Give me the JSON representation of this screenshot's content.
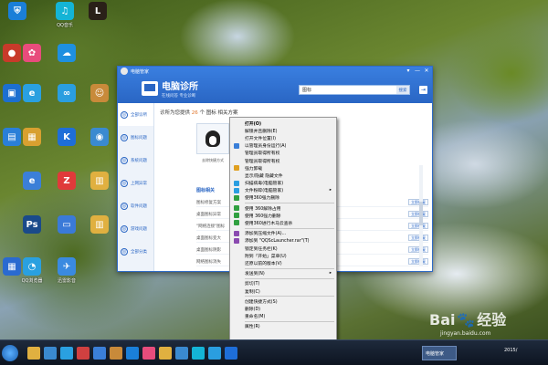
{
  "desktop": {
    "icons": [
      {
        "label": "",
        "color": "#1a7fd8",
        "glyph": "⛨"
      },
      {
        "label": "QQ音乐",
        "color": "#14b4d6",
        "glyph": "♫"
      },
      {
        "label": "",
        "color": "#2a2018",
        "glyph": "L"
      },
      {
        "label": "",
        "color": "#c83a2a",
        "glyph": "●"
      },
      {
        "label": "",
        "color": "#e84c7c",
        "glyph": "✿"
      },
      {
        "label": "",
        "color": "#1e90e0",
        "glyph": "☁"
      },
      {
        "label": "",
        "color": "#1c6fd0",
        "glyph": "▣"
      },
      {
        "label": "",
        "color": "#2aa0e0",
        "glyph": "e"
      },
      {
        "label": "",
        "color": "#2a9ee0",
        "glyph": "∞"
      },
      {
        "label": "",
        "color": "#c88a3a",
        "glyph": "☺"
      },
      {
        "label": "",
        "color": "#2a7fd8",
        "glyph": "▤"
      },
      {
        "label": "",
        "color": "#d8a030",
        "glyph": "▦"
      },
      {
        "label": "",
        "color": "#1e6ed8",
        "glyph": "K"
      },
      {
        "label": "",
        "color": "#3a8ad0",
        "glyph": "◉"
      },
      {
        "label": "",
        "color": "#3b7fd8",
        "glyph": "e"
      },
      {
        "label": "",
        "color": "#e03a3a",
        "glyph": "Z"
      },
      {
        "label": "",
        "color": "#e0b040",
        "glyph": "▥"
      },
      {
        "label": "",
        "color": "#1a4a8a",
        "glyph": "Ps"
      },
      {
        "label": "",
        "color": "#3a7ad8",
        "glyph": "▭"
      },
      {
        "label": "",
        "color": "#e0b040",
        "glyph": "▥"
      },
      {
        "label": "",
        "color": "#2a6ad0",
        "glyph": "▦"
      },
      {
        "label": "QQ浏览器",
        "color": "#2aa0e0",
        "glyph": "◔"
      },
      {
        "label": "迅雷影音",
        "color": "#3a8ae0",
        "glyph": "✈"
      }
    ]
  },
  "window": {
    "title": "电脑管家",
    "brand_title": "电脑诊所",
    "brand_subtitle": "在线问答 专业诊断",
    "search_value": "图标",
    "search_button": "搜索",
    "controls": {
      "skin": "▾",
      "minimize": "—",
      "close": "✕"
    },
    "sidebar": [
      {
        "label": "全部诊所",
        "icon": "◎"
      },
      {
        "label": "图标问题",
        "icon": "◎"
      },
      {
        "label": "系统问题",
        "icon": "◎"
      },
      {
        "label": "上网异常",
        "icon": "◎"
      },
      {
        "label": "软件问题",
        "icon": "◎"
      },
      {
        "label": "游戏问题",
        "icon": "◎"
      },
      {
        "label": "全部分类",
        "icon": "◎"
      }
    ],
    "heading_prefix": "诊所为您提供",
    "heading_count": "26",
    "heading_suffix": "个 图标 相关方案",
    "card_label": "去除快捷方式",
    "section_head": "图标相关",
    "rows": [
      {
        "text": "图标修复方案",
        "button": "立即修复"
      },
      {
        "text": "桌面图标异常",
        "button": "立即修复"
      },
      {
        "text": "\"网络连接\"图标",
        "button": "立即修复"
      },
      {
        "text": "桌面图标变大",
        "button": "立即修复"
      },
      {
        "text": "桌面图标阴影",
        "button": "立即修复"
      },
      {
        "text": "网络图标消失",
        "button": "立即修复"
      }
    ]
  },
  "context_menu": {
    "items": [
      {
        "label": "打开(O)",
        "bold": true,
        "icon": "",
        "arrow": false,
        "sep_after": false
      },
      {
        "label": "解锁并且删除(E)",
        "icon": "",
        "arrow": false,
        "sep_after": false
      },
      {
        "label": "打开文件位置(I)",
        "icon": "",
        "arrow": false,
        "sep_after": false
      },
      {
        "label": "以管理员身份运行(A)",
        "icon": "#3a7fd8",
        "arrow": false,
        "sep_after": false
      },
      {
        "label": "管理员取得所有权",
        "icon": "",
        "arrow": false,
        "sep_after": false
      },
      {
        "label": "管理员取得所有权",
        "icon": "",
        "arrow": false,
        "sep_after": false
      },
      {
        "label": "强力卸载",
        "icon": "#e0a020",
        "arrow": false,
        "sep_after": false
      },
      {
        "label": "显示/隐藏 隐藏文件",
        "icon": "",
        "arrow": false,
        "sep_after": false
      },
      {
        "label": "扫描病毒(电脑管家)",
        "icon": "#2a9ee0",
        "arrow": false,
        "sep_after": false
      },
      {
        "label": "文件粉碎(电脑管家)",
        "icon": "#2a9ee0",
        "arrow": true,
        "sep_after": false
      },
      {
        "label": "使用360强力删除",
        "icon": "#30a040",
        "arrow": false,
        "sep_after": true
      },
      {
        "label": "使用 360解除占用",
        "icon": "#30a040",
        "arrow": false,
        "sep_after": false
      },
      {
        "label": "使用 360强力删除",
        "icon": "#30a040",
        "arrow": false,
        "sep_after": false
      },
      {
        "label": "使用360进行木马云查杀",
        "icon": "#30a040",
        "arrow": false,
        "sep_after": true
      },
      {
        "label": "添加到压缩文件(A)...",
        "icon": "#8a4ab0",
        "arrow": false,
        "sep_after": false
      },
      {
        "label": "添加到 \"QQScLauncher.rar\"(T)",
        "icon": "#8a4ab0",
        "arrow": false,
        "sep_after": false
      },
      {
        "label": "锁定到任务栏(K)",
        "icon": "",
        "arrow": false,
        "sep_after": false
      },
      {
        "label": "附到「开始」菜单(U)",
        "icon": "",
        "arrow": false,
        "sep_after": false
      },
      {
        "label": "还原以前的版本(V)",
        "icon": "",
        "arrow": false,
        "sep_after": true
      },
      {
        "label": "发送到(N)",
        "icon": "",
        "arrow": true,
        "sep_after": true
      },
      {
        "label": "剪切(T)",
        "icon": "",
        "arrow": false,
        "sep_after": false
      },
      {
        "label": "复制(C)",
        "icon": "",
        "arrow": false,
        "sep_after": true
      },
      {
        "label": "创建快捷方式(S)",
        "icon": "",
        "arrow": false,
        "sep_after": false
      },
      {
        "label": "删除(D)",
        "icon": "",
        "arrow": false,
        "sep_after": false
      },
      {
        "label": "重命名(M)",
        "icon": "",
        "arrow": false,
        "sep_after": true
      },
      {
        "label": "属性(R)",
        "icon": "",
        "arrow": false,
        "sep_after": false
      }
    ]
  },
  "taskbar": {
    "icons": [
      {
        "color": "#e0b040"
      },
      {
        "color": "#3a8ad0"
      },
      {
        "color": "#2aa0e0"
      },
      {
        "color": "#d04040"
      },
      {
        "color": "#3b7fd8"
      },
      {
        "color": "#c88a3a"
      },
      {
        "color": "#1a7fd8"
      },
      {
        "color": "#e84c7c"
      },
      {
        "color": "#e0b040"
      },
      {
        "color": "#3a8ad0"
      },
      {
        "color": "#14b4d6"
      },
      {
        "color": "#2a9ee0"
      },
      {
        "color": "#1e6ed8"
      }
    ],
    "active_app": "电脑管家",
    "clock": "2015/"
  },
  "watermark": {
    "big": "Bai",
    "big2": "经验",
    "small": "jingyan.baidu.com"
  }
}
